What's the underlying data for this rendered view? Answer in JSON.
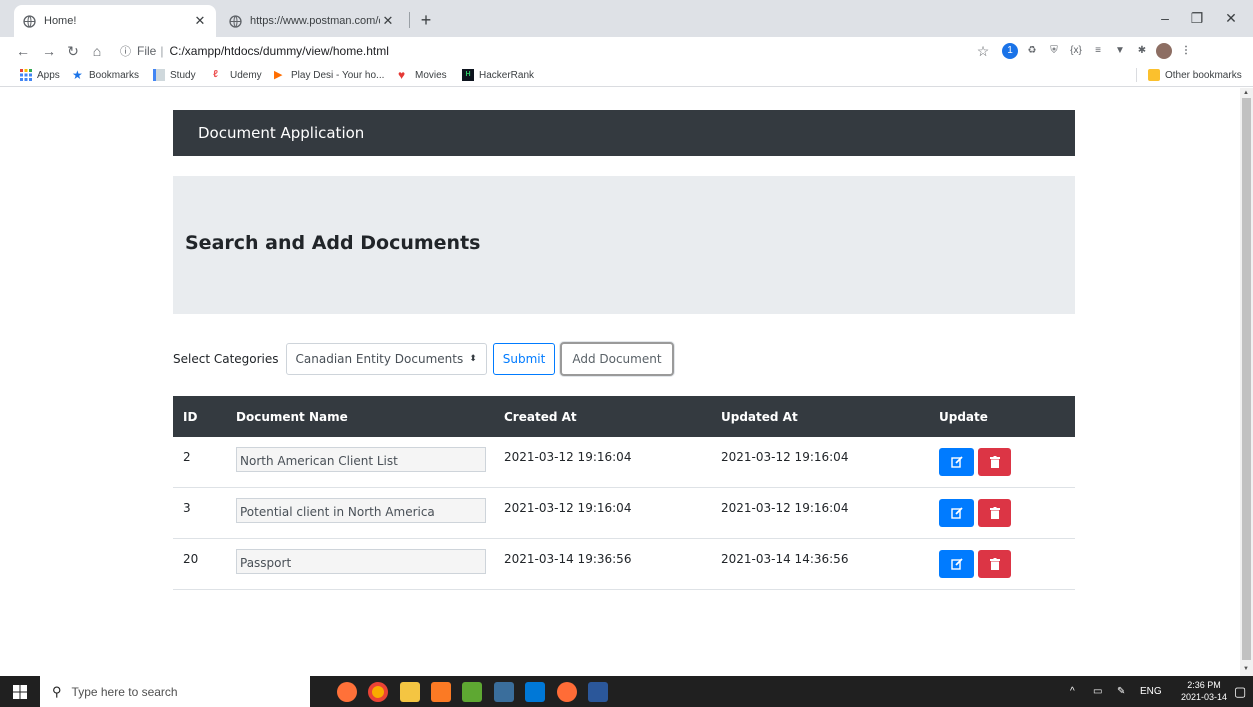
{
  "browser": {
    "tabs": [
      {
        "title": "Home!",
        "active": true
      },
      {
        "title": "https://www.postman.com/collec",
        "active": false
      }
    ],
    "address": {
      "scheme": "File",
      "path": "C:/xampp/htdocs/dummy/view/home.html"
    },
    "bookmarks": [
      {
        "label": "Apps",
        "icon": "apps-grid-icon"
      },
      {
        "label": "Bookmarks",
        "icon": "star-icon"
      },
      {
        "label": "Study",
        "icon": "folder-icon"
      },
      {
        "label": "Udemy",
        "icon": "udemy-icon"
      },
      {
        "label": "Play Desi - Your ho...",
        "icon": "play-icon"
      },
      {
        "label": "Movies",
        "icon": "heart-icon"
      },
      {
        "label": "HackerRank",
        "icon": "hackerrank-icon"
      }
    ],
    "other_bookmarks": "Other bookmarks",
    "extension_badge": "1"
  },
  "app": {
    "brand": "Document Application",
    "heading": "Search and Add Documents",
    "controls": {
      "category_label": "Select Categories",
      "category_selected": "Canadian Entity Documents",
      "submit_label": "Submit",
      "add_label": "Add Document"
    },
    "table": {
      "headers": {
        "id": "ID",
        "name": "Document Name",
        "created": "Created At",
        "updated": "Updated At",
        "update": "Update"
      },
      "rows": [
        {
          "id": "2",
          "name": "North American Client List",
          "created": "2021-03-12 19:16:04",
          "updated": "2021-03-12 19:16:04"
        },
        {
          "id": "3",
          "name": "Potential client in North America",
          "created": "2021-03-12 19:16:04",
          "updated": "2021-03-12 19:16:04"
        },
        {
          "id": "20",
          "name": "Passport",
          "created": "2021-03-14 19:36:56",
          "updated": "2021-03-14 14:36:56"
        }
      ]
    }
  },
  "taskbar": {
    "search_placeholder": "Type here to search",
    "lang": "ENG",
    "time": "2:36 PM",
    "date": "2021-03-14"
  },
  "colors": {
    "navbar": "#343a40",
    "jumbotron": "#e9ecef",
    "primary": "#007bff",
    "danger": "#dc3545"
  }
}
